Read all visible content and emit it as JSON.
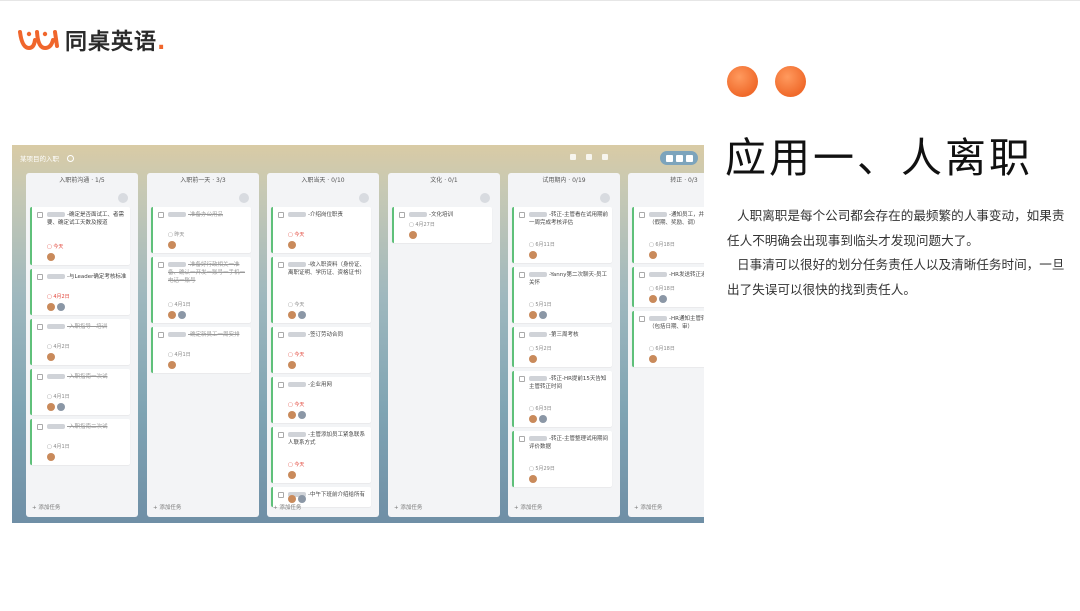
{
  "logo": {
    "text": "同桌英语",
    "dot": "."
  },
  "heading": "应用一、人离职",
  "description": [
    "人职离职是每个公司都会存在的最频繁的人事变动，如果责任人不明确会出现事到临头才发现问题大了。",
    "日事清可以很好的划分任务责任人以及清晰任务时间，一旦出了失误可以很快的找到责任人。"
  ],
  "colors": {
    "accent": "#f06a2b",
    "done_bar": "#5fc07a"
  },
  "screenshot": {
    "project": "某项目的入职",
    "columns": [
      {
        "header": "入职前沟通 · 1/5",
        "footer": "+ 添加任务",
        "cards": [
          {
            "text": "-确定是否面试工、者需要、确定试工天数及报道",
            "meta": "今天",
            "meta_red": true,
            "done": false
          },
          {
            "text": "-与Leader确定考核标准",
            "meta": "4月2日",
            "meta_red": true,
            "done": false
          },
          {
            "text": "-入职指导 · 培训",
            "meta": "4月2日",
            "meta_red": false,
            "done": true
          },
          {
            "text": "-入职指南一次试",
            "meta": "4月1日",
            "meta_red": false,
            "done": true
          },
          {
            "text": "-入职指南二次试",
            "meta": "4月1日",
            "meta_red": false,
            "done": true
          }
        ]
      },
      {
        "header": "入职前一天 · 3/3",
        "footer": "+ 添加任务",
        "cards": [
          {
            "text": "-准备办公用品",
            "meta": "昨天",
            "meta_red": false,
            "done": true
          },
          {
            "text": "-准备好行政相关一准备、确认一开发一账号一手机一电话一账号",
            "meta": "4月1日",
            "meta_red": false,
            "done": true
          },
          {
            "text": "-确定新员工一周安排",
            "meta": "4月1日",
            "meta_red": false,
            "done": true
          }
        ]
      },
      {
        "header": "入职当天 · 0/10",
        "footer": "+ 添加任务",
        "cards": [
          {
            "text": "-介绍岗位职责",
            "meta": "今天",
            "meta_red": true,
            "done": false
          },
          {
            "text": "-收入职资料（身份证、离职证明、学历证、资格证书）",
            "meta": "今天",
            "meta_red": false,
            "done": false
          },
          {
            "text": "-签订劳动合同",
            "meta": "今天",
            "meta_red": true,
            "done": false
          },
          {
            "text": "-企业用网",
            "meta": "今天",
            "meta_red": true,
            "done": false
          },
          {
            "text": "-主管添加员工紧急联系人联系方式",
            "meta": "今天",
            "meta_red": true,
            "done": false
          },
          {
            "text": "-中午下班前介绍给所有",
            "meta": "",
            "meta_red": false,
            "done": false
          }
        ]
      },
      {
        "header": "文化 · 0/1",
        "footer": "+ 添加任务",
        "cards": [
          {
            "text": "-文化培训",
            "meta": "4月27日",
            "meta_red": false,
            "done": false
          }
        ]
      },
      {
        "header": "试用期内 · 0/19",
        "footer": "+ 添加任务",
        "cards": [
          {
            "text": "-转正-主管看在试用期前一周完成考核评估",
            "meta": "6月11日",
            "meta_red": false,
            "done": false
          },
          {
            "text": "-Yanny第二次聊天-员工关怀",
            "meta": "5月1日",
            "meta_red": false,
            "done": false
          },
          {
            "text": "-第三周考核",
            "meta": "5月2日",
            "meta_red": false,
            "done": false
          },
          {
            "text": "-转正-HR提前15天告知主管转正时间",
            "meta": "6月3日",
            "meta_red": false,
            "done": false
          },
          {
            "text": "-转正-主管整理试用期间评价数据",
            "meta": "5月29日",
            "meta_red": false,
            "done": false
          }
        ]
      },
      {
        "header": "转正 · 0/3",
        "footer": "+ 添加任务",
        "cards": [
          {
            "text": "-通知员工，并正式结（假期、奖励、调）",
            "meta": "6月18日",
            "meta_red": false,
            "done": false
          },
          {
            "text": "-HR发送转正通",
            "meta": "6月18日",
            "meta_red": false,
            "done": false
          },
          {
            "text": "-HR通知主管转正流程（包括日期、审）",
            "meta": "6月18日",
            "meta_red": false,
            "done": false
          }
        ]
      }
    ]
  }
}
